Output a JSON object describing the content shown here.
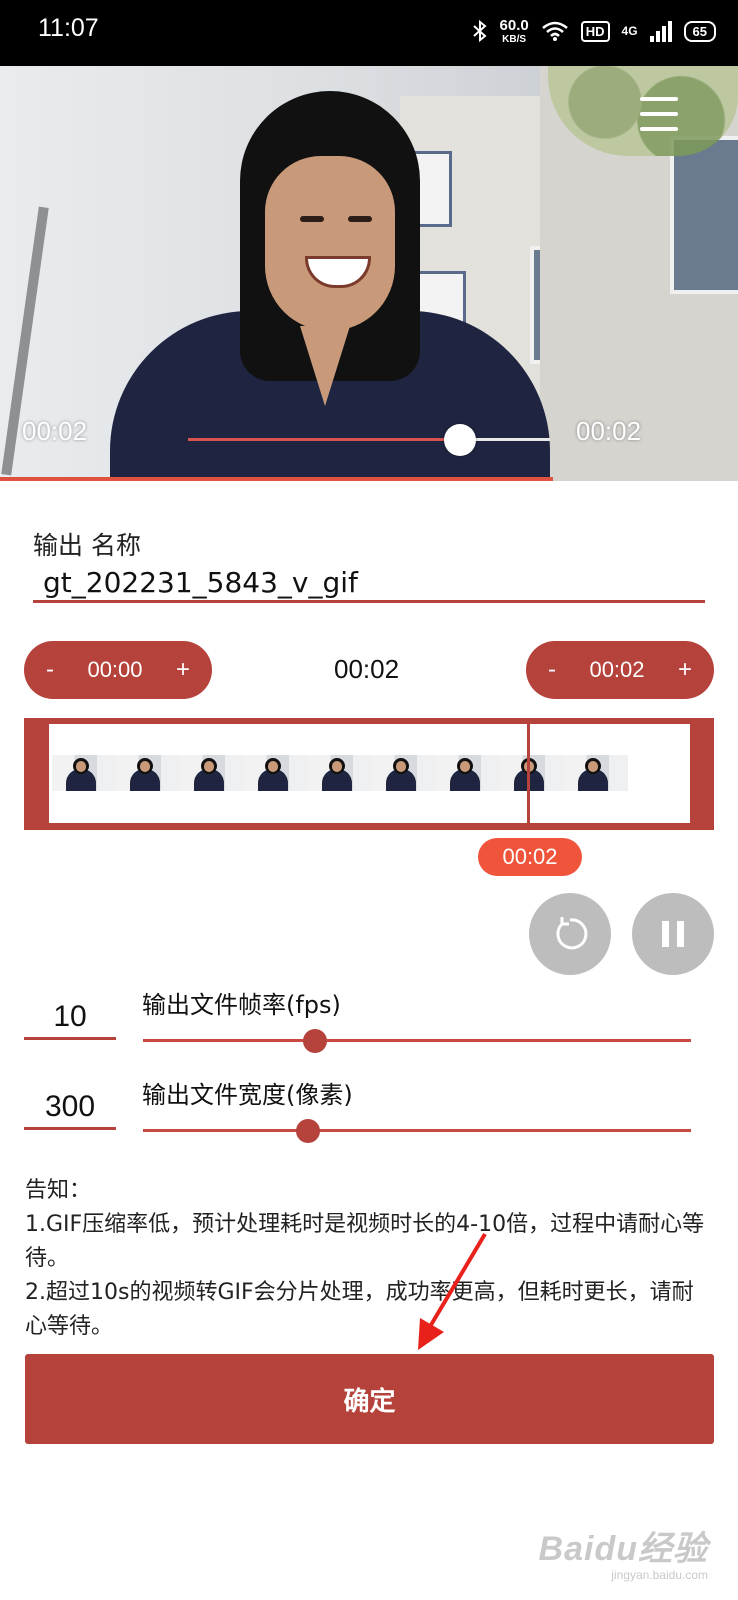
{
  "status_bar": {
    "time": "11:07",
    "net_speed_value": "60.0",
    "net_speed_unit": "KB/S",
    "hd": "HD",
    "network": "4G",
    "battery": "65"
  },
  "player": {
    "current_time": "00:02",
    "total_time": "00:02",
    "progress": 0.75
  },
  "output_name": {
    "label": "输出 名称",
    "value": "gt_202231_5843_v_gif"
  },
  "trim": {
    "start": {
      "minus": "-",
      "value": "00:00",
      "plus": "+"
    },
    "duration": "00:02",
    "end": {
      "minus": "-",
      "value": "00:02",
      "plus": "+"
    },
    "cursor_time": "00:02",
    "thumbnail_count": 9
  },
  "controls": {
    "replay_icon": "replay-icon",
    "pause_icon": "pause-icon"
  },
  "fps": {
    "value": "10",
    "label": "输出文件帧率(fps)"
  },
  "width": {
    "value": "300",
    "label": "输出文件宽度(像素)"
  },
  "notice": {
    "title": "告知：",
    "line1": "1.GIF压缩率低，预计处理耗时是视频时长的4-10倍，过程中请耐心等待。",
    "line2": "2.超过10s的视频转GIF会分片处理，成功率更高，但耗时更长，请耐心等待。"
  },
  "confirm_label": "确定",
  "watermark": {
    "logo": "Baidu经验",
    "url": "jingyan.baidu.com"
  },
  "colors": {
    "accent": "#b5423b",
    "badge": "#f0543a",
    "round_button": "#bdbdbd"
  }
}
